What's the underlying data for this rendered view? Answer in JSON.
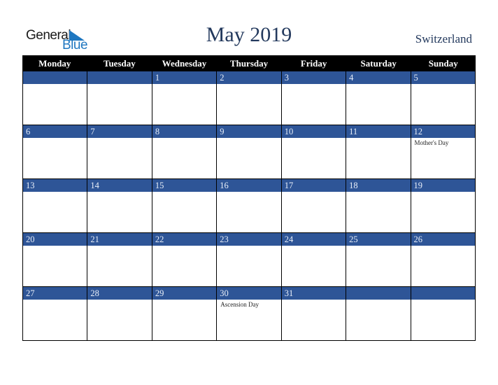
{
  "logo": {
    "line1": "General",
    "line2": "Blue",
    "icon": "triangle-flag-icon",
    "color": "#1f77c0"
  },
  "title": "May 2019",
  "country": "Switzerland",
  "colors": {
    "header_bg": "#000000",
    "band_bg": "#2e5597",
    "title": "#23395d"
  },
  "weekdays": [
    "Monday",
    "Tuesday",
    "Wednesday",
    "Thursday",
    "Friday",
    "Saturday",
    "Sunday"
  ],
  "weeks": [
    [
      {
        "day": "",
        "event": ""
      },
      {
        "day": "",
        "event": ""
      },
      {
        "day": "1",
        "event": ""
      },
      {
        "day": "2",
        "event": ""
      },
      {
        "day": "3",
        "event": ""
      },
      {
        "day": "4",
        "event": ""
      },
      {
        "day": "5",
        "event": ""
      }
    ],
    [
      {
        "day": "6",
        "event": ""
      },
      {
        "day": "7",
        "event": ""
      },
      {
        "day": "8",
        "event": ""
      },
      {
        "day": "9",
        "event": ""
      },
      {
        "day": "10",
        "event": ""
      },
      {
        "day": "11",
        "event": ""
      },
      {
        "day": "12",
        "event": "Mother's Day"
      }
    ],
    [
      {
        "day": "13",
        "event": ""
      },
      {
        "day": "14",
        "event": ""
      },
      {
        "day": "15",
        "event": ""
      },
      {
        "day": "16",
        "event": ""
      },
      {
        "day": "17",
        "event": ""
      },
      {
        "day": "18",
        "event": ""
      },
      {
        "day": "19",
        "event": ""
      }
    ],
    [
      {
        "day": "20",
        "event": ""
      },
      {
        "day": "21",
        "event": ""
      },
      {
        "day": "22",
        "event": ""
      },
      {
        "day": "23",
        "event": ""
      },
      {
        "day": "24",
        "event": ""
      },
      {
        "day": "25",
        "event": ""
      },
      {
        "day": "26",
        "event": ""
      }
    ],
    [
      {
        "day": "27",
        "event": ""
      },
      {
        "day": "28",
        "event": ""
      },
      {
        "day": "29",
        "event": ""
      },
      {
        "day": "30",
        "event": "Ascension Day"
      },
      {
        "day": "31",
        "event": ""
      },
      {
        "day": "",
        "event": ""
      },
      {
        "day": "",
        "event": ""
      }
    ]
  ]
}
